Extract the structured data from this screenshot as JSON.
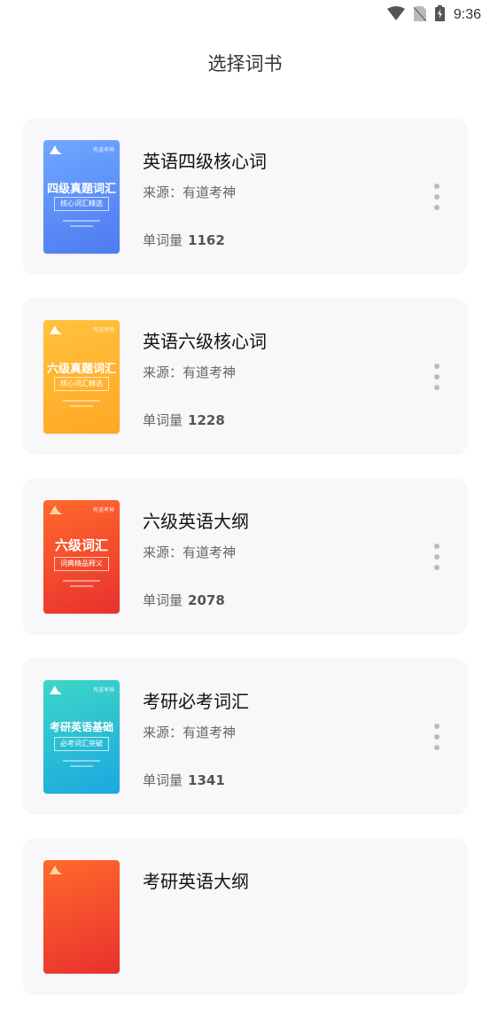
{
  "status_bar": {
    "time": "9:36"
  },
  "header": {
    "title": "选择词书"
  },
  "books": [
    {
      "title": "英语四级核心词",
      "source": "来源：有道考神",
      "count_label": "单词量",
      "count": "1162",
      "cover": {
        "title": "四级真题词汇",
        "subtitle": "核心词汇精选",
        "tag": "有道考神",
        "colors": [
          "#6fa8ff",
          "#4e7af0"
        ]
      }
    },
    {
      "title": "英语六级核心词",
      "source": "来源：有道考神",
      "count_label": "单词量",
      "count": "1228",
      "cover": {
        "title": "六级真题词汇",
        "subtitle": "核心词汇精选",
        "tag": "有道考神",
        "colors": [
          "#ffc23c",
          "#ffa726"
        ]
      }
    },
    {
      "title": "六级英语大纲",
      "source": "来源：有道考神",
      "count_label": "单词量",
      "count": "2078",
      "cover": {
        "title": "六级词汇",
        "subtitle": "词典精品释义",
        "tag": "有道考神",
        "colors": [
          "#ff6a2c",
          "#e8312e"
        ]
      }
    },
    {
      "title": "考研必考词汇",
      "source": "来源：有道考神",
      "count_label": "单词量",
      "count": "1341",
      "cover": {
        "title": "考研英语基础",
        "subtitle": "必考词汇突破",
        "tag": "有道考神",
        "colors": [
          "#3fd6c6",
          "#1aa8e0"
        ]
      }
    },
    {
      "title": "考研英语大纲",
      "source": "",
      "count_label": "",
      "count": "",
      "cover": {
        "title": "",
        "subtitle": "",
        "tag": "",
        "colors": [
          "#ff6a2c",
          "#e8312e"
        ]
      }
    }
  ]
}
